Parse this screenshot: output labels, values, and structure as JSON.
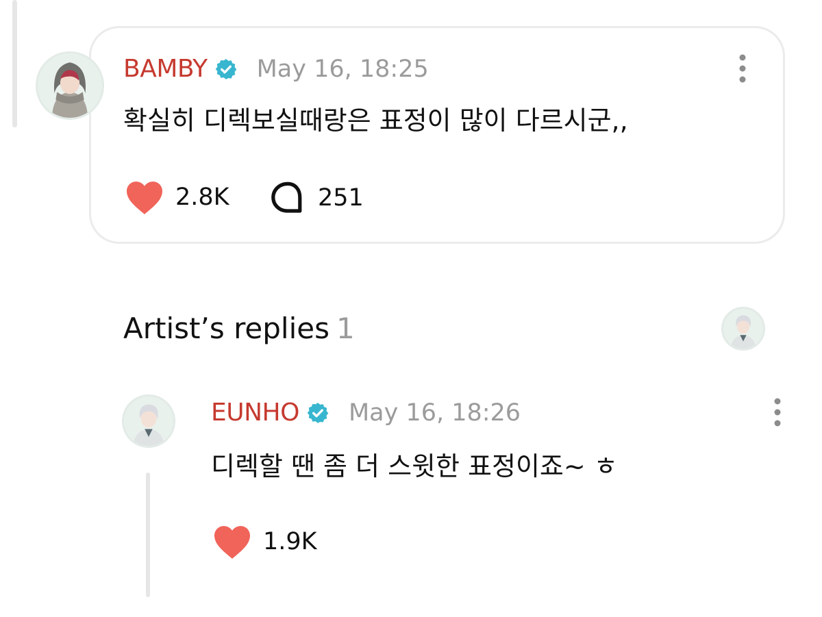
{
  "colors": {
    "author": "#c63a2f",
    "verified_badge": "#38b6cf",
    "heart": "#f0645a",
    "muted": "#9b9b9b"
  },
  "comment": {
    "author": "BAMBY",
    "verified_icon": "verified-badge-icon",
    "timestamp": "May 16, 18:25",
    "text": "확실히 디렉보실때랑은 표정이 많이 다르시군,,",
    "like_icon": "heart-icon",
    "likes": "2.8K",
    "reply_icon": "speech-bubble-icon",
    "replies": "251",
    "menu_icon": "more-vertical-icon"
  },
  "artist_replies": {
    "title": "Artist’s replies",
    "count": "1"
  },
  "reply": {
    "author": "EUNHO",
    "verified_icon": "verified-badge-icon",
    "timestamp": "May 16, 18:26",
    "text": "디렉할 땐 좀 더 스윗한 표정이죠~ ㅎ",
    "like_icon": "heart-icon",
    "likes": "1.9K",
    "menu_icon": "more-vertical-icon"
  }
}
